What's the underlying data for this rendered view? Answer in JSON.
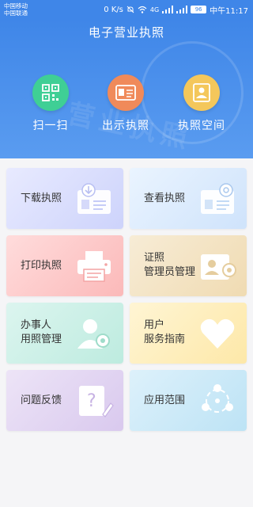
{
  "status_bar": {
    "carrier_1": "中国移动",
    "carrier_2": "中国联通",
    "speed": "0 K/s",
    "network": "4G",
    "battery": "96",
    "time": "中午11:17"
  },
  "header": {
    "title": "电子营业执照",
    "watermark": "营业执照"
  },
  "actions": [
    {
      "label": "扫一扫",
      "icon": "qr-code-icon",
      "color": "#3fcf95"
    },
    {
      "label": "出示执照",
      "icon": "license-card-icon",
      "color": "#f08a5a"
    },
    {
      "label": "执照空间",
      "icon": "person-badge-icon",
      "color": "#f4c75b"
    }
  ],
  "cards": [
    {
      "lines": [
        "下载执照"
      ],
      "icon": "download-license-icon"
    },
    {
      "lines": [
        "查看执照"
      ],
      "icon": "view-license-icon"
    },
    {
      "lines": [
        "打印执照"
      ],
      "icon": "printer-icon"
    },
    {
      "lines": [
        "证照",
        "管理员管理"
      ],
      "icon": "admin-license-icon"
    },
    {
      "lines": [
        "办事人",
        "用照管理"
      ],
      "icon": "user-gear-icon"
    },
    {
      "lines": [
        "用户",
        "服务指南"
      ],
      "icon": "heart-icon"
    },
    {
      "lines": [
        "问题反馈"
      ],
      "icon": "question-feedback-icon"
    },
    {
      "lines": [
        "应用范围"
      ],
      "icon": "network-icon"
    }
  ]
}
